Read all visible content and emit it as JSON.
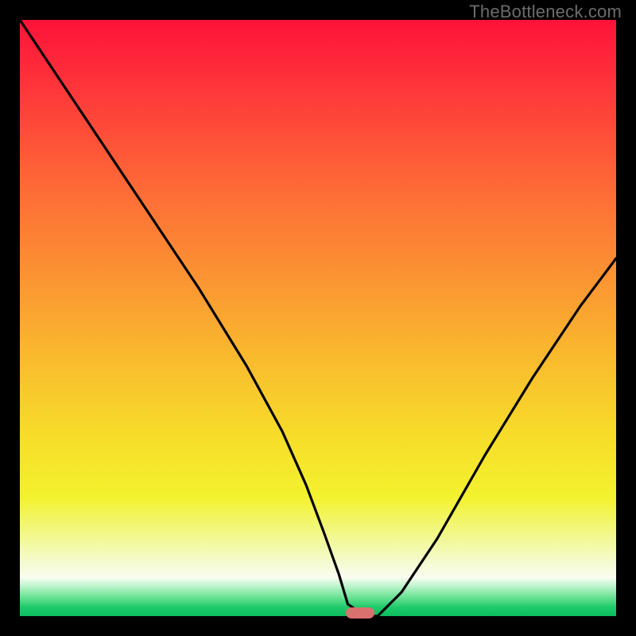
{
  "watermark": "TheBottleneck.com",
  "chart_data": {
    "type": "line",
    "title": "",
    "xlabel": "",
    "ylabel": "",
    "xlim": [
      0,
      100
    ],
    "ylim": [
      0,
      100
    ],
    "grid": false,
    "series": [
      {
        "name": "bottleneck-curve",
        "x": [
          0,
          8,
          14,
          22,
          30,
          38,
          44,
          48,
          51,
          53.5,
          55,
          58,
          60,
          64,
          70,
          78,
          86,
          94,
          100
        ],
        "values": [
          100,
          88,
          79,
          67,
          55,
          42,
          31,
          22,
          14,
          7,
          2,
          0,
          0,
          4,
          13,
          27,
          40,
          52,
          60
        ]
      }
    ],
    "marker": {
      "x": 57,
      "y": 0.6,
      "label": "optimal-zone"
    },
    "background_gradient_stops": [
      {
        "pos": 0,
        "color": "#fe1239"
      },
      {
        "pos": 0.5,
        "color": "#f9bb2e"
      },
      {
        "pos": 0.8,
        "color": "#f3f22e"
      },
      {
        "pos": 0.95,
        "color": "#bcf4cb"
      },
      {
        "pos": 1.0,
        "color": "#0bbd5c"
      }
    ]
  }
}
